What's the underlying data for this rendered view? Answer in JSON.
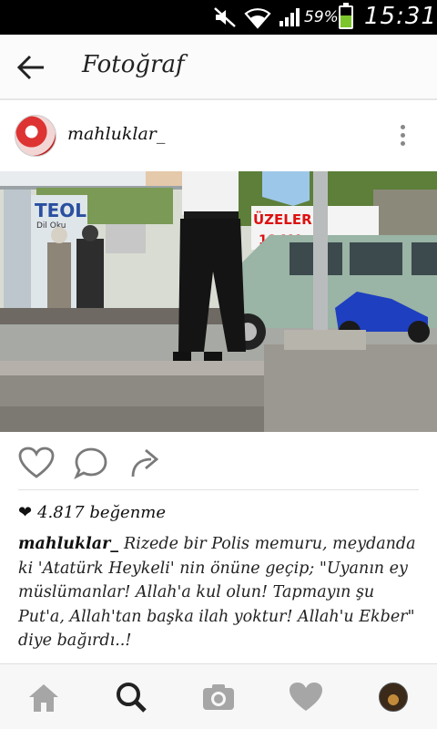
{
  "status_bar": {
    "battery_text": "59%",
    "battery_level": 0.59,
    "time": "15:31",
    "icons": [
      "mute-icon",
      "wifi-icon",
      "signal-icon",
      "battery-icon"
    ]
  },
  "app_bar": {
    "title": "Fotoğraf",
    "back_icon": "back-arrow-icon"
  },
  "post": {
    "username": "mahluklar_",
    "photo_signs": {
      "store_sign": "TEOL",
      "store_sub": "Dil Oku",
      "banner": "ÜZELER Ç",
      "banner_sub": "18 MA"
    },
    "likes": "4.817 beğenme",
    "caption_user": "mahluklar_",
    "caption_text": "Rizede bir Polis memuru, meydanda ki 'Atatürk Heykeli' nin önüne geçip; \"Uyanın ey müslümanlar! Allah'a kul olun! Tapmayın şu Put'a, Allah'tan başka ilah yoktur! Allah'u Ekber\" diye bağırdı..!"
  },
  "bottom_nav": {
    "items": [
      "home-icon",
      "search-icon",
      "camera-icon",
      "heart-icon",
      "profile-avatar"
    ]
  },
  "colors": {
    "status_bg": "#000000",
    "battery_fill": "#7cc62b",
    "text": "#111111",
    "icon_gray": "#9a9a9a"
  }
}
